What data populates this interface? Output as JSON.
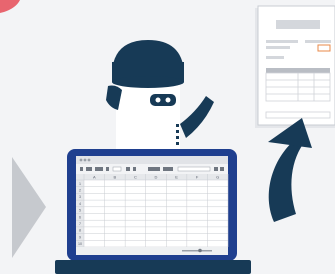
{
  "illustration": {
    "subject": "robot generating a document from a spreadsheet on a laptop",
    "colors": {
      "background": "#f3f4f6",
      "navy": "#173a56",
      "laptop_blue": "#1f3f8f",
      "arrow_gray": "#c6c9ce",
      "accent_pink": "#e8656f",
      "accent_orange": "#e88a4a",
      "paper": "#ffffff",
      "paper_shade": "#e4e6ea"
    },
    "icons": [
      "robot-icon",
      "laptop-icon",
      "spreadsheet-icon",
      "document-icon",
      "curved-arrow-icon",
      "chevron-right-icon"
    ]
  },
  "spreadsheet": {
    "columns": [
      "A",
      "B",
      "C",
      "D",
      "E",
      "F",
      "G"
    ],
    "rows": [
      "1",
      "2",
      "3",
      "4",
      "5",
      "6",
      "7",
      "8",
      "9",
      "10"
    ]
  }
}
